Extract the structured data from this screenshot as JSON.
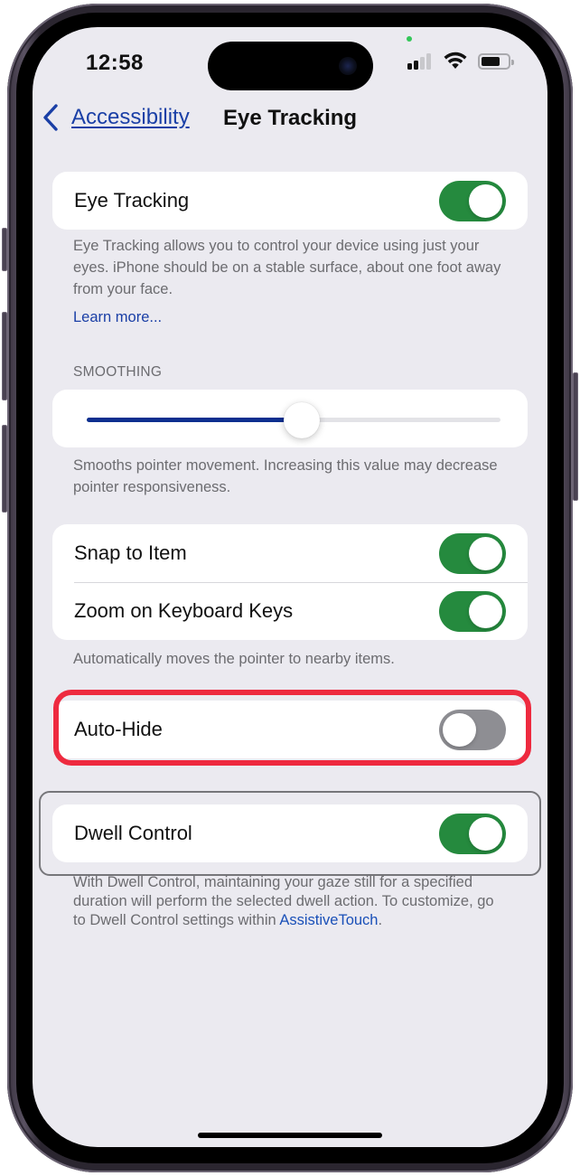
{
  "status_bar": {
    "time": "12:58",
    "signal_bars_total": 4,
    "signal_bars_active": 2,
    "battery_level": 0.7,
    "privacy_indicator_color": "#34c759"
  },
  "nav": {
    "back_label": "Accessibility",
    "title": "Eye Tracking"
  },
  "eye_tracking": {
    "label": "Eye Tracking",
    "enabled": true,
    "description": "Eye Tracking allows you to control your device using just your eyes. iPhone should be on a stable surface, about one foot away from your face.",
    "learn_more": "Learn more..."
  },
  "smoothing": {
    "header": "SMOOTHING",
    "value": 0.52,
    "description": "Smooths pointer movement. Increasing this value may decrease pointer responsiveness."
  },
  "pointer_group": {
    "items": [
      {
        "label": "Snap to Item",
        "enabled": true
      },
      {
        "label": "Zoom on Keyboard Keys",
        "enabled": true
      }
    ],
    "description": "Automatically moves the pointer to nearby items."
  },
  "auto_hide": {
    "label": "Auto-Hide",
    "enabled": false
  },
  "dwell_control": {
    "label": "Dwell Control",
    "enabled": true,
    "description_prefix": "With Dwell Control, maintaining your gaze still for a specified duration will perform the selected dwell action. To customize, go to Dwell Control settings within ",
    "description_link": "AssistiveTouch",
    "description_suffix": "."
  },
  "colors": {
    "toggle_on": "#258a3e",
    "toggle_off": "#8e8e93",
    "slider_fill": "#0d2f8f",
    "link": "#1a3fa6",
    "highlight_red": "#ee2a3f",
    "background": "#ebeaf0"
  }
}
